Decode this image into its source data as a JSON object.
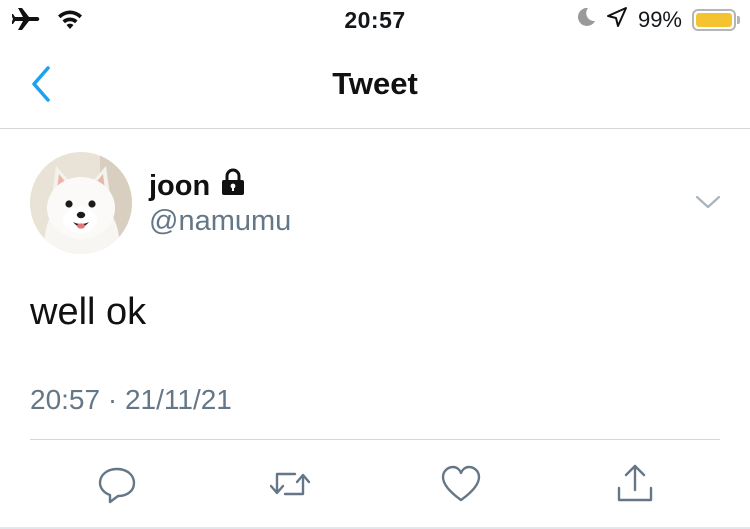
{
  "status_bar": {
    "time": "20:57",
    "battery_percent": "99%",
    "battery_level": 0.99,
    "icons": [
      "airplane-icon",
      "wifi-icon",
      "moon-icon",
      "location-arrow-icon",
      "battery-icon"
    ],
    "battery_color": "#f4c430"
  },
  "nav": {
    "title": "Tweet",
    "back_icon": "chevron-left-icon",
    "accent_color": "#1da1f2"
  },
  "tweet": {
    "author_name": "joon",
    "author_handle": "@namumu",
    "protected_icon": "lock-icon",
    "text": "well ok",
    "timestamp": "20:57 · 21/11/21",
    "menu_icon": "chevron-down-icon"
  },
  "actions": [
    {
      "icon": "reply-icon"
    },
    {
      "icon": "retweet-icon"
    },
    {
      "icon": "like-icon"
    },
    {
      "icon": "share-icon"
    }
  ]
}
